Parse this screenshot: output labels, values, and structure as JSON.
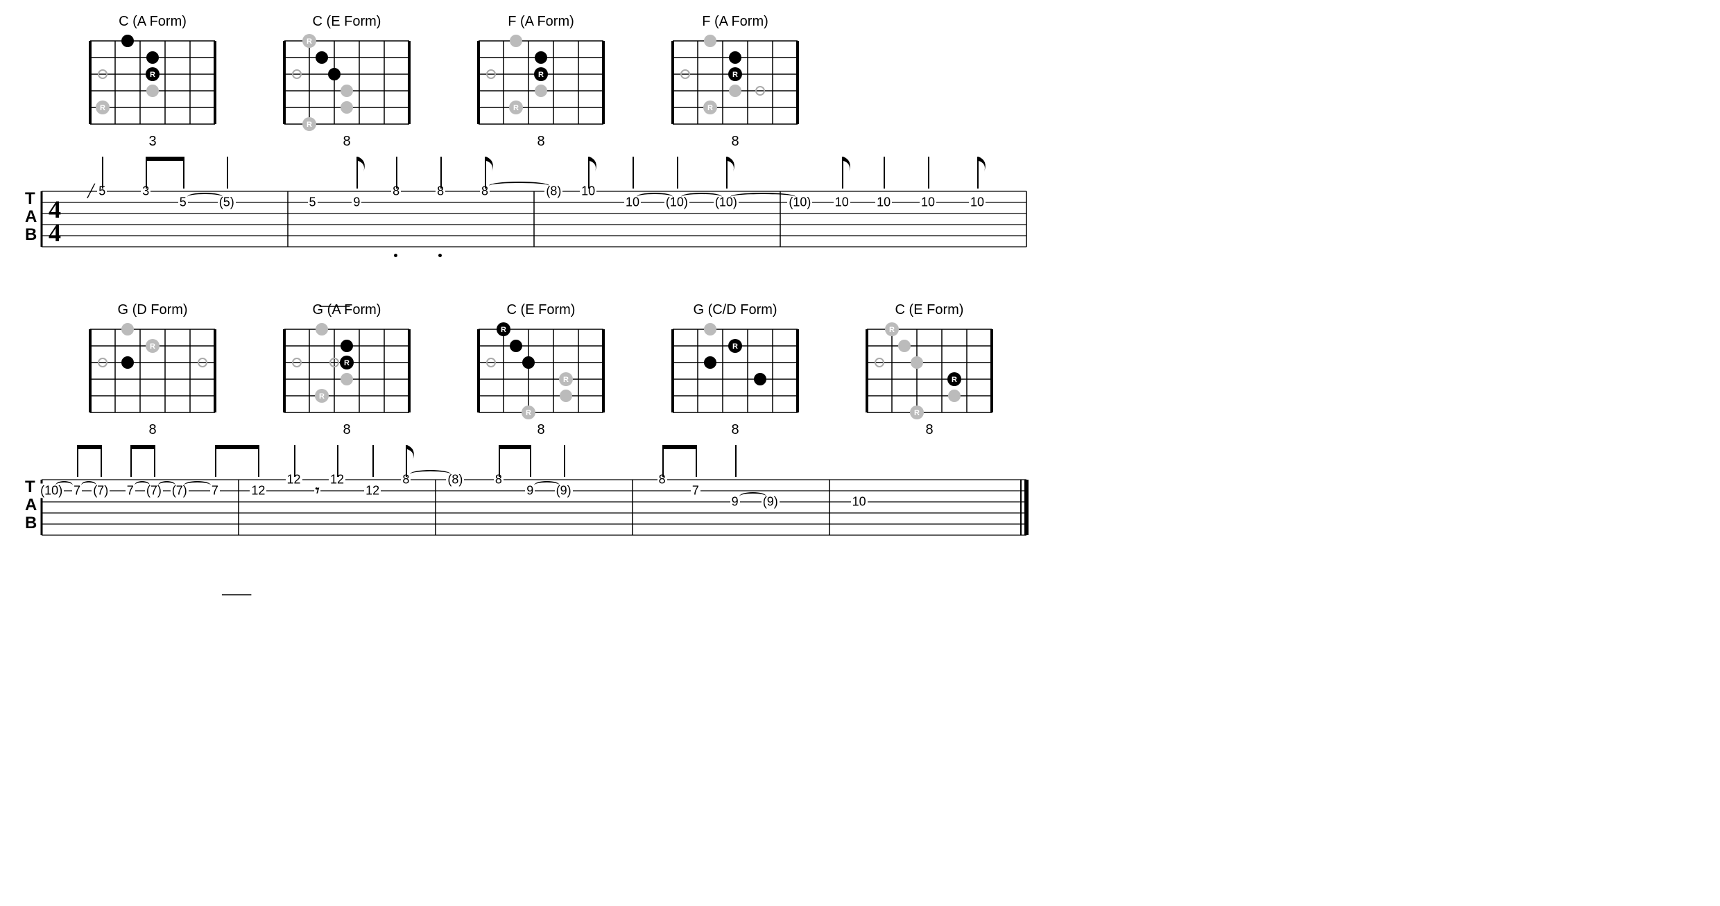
{
  "time_signature": "4/4",
  "tab_label": "TAB",
  "rows": [
    {
      "chords": [
        {
          "title": "C (A Form)",
          "position": "3",
          "dots": [
            {
              "string": 1,
              "fret": 2,
              "type": "black"
            },
            {
              "string": 2,
              "fret": 3,
              "type": "black"
            },
            {
              "string": 3,
              "fret": 3,
              "type": "root"
            },
            {
              "string": 3,
              "fret": 1,
              "type": "open"
            },
            {
              "string": 4,
              "fret": 3,
              "type": "grey"
            },
            {
              "string": 5,
              "fret": 1,
              "type": "greyroot"
            }
          ]
        },
        {
          "title": "C (E Form)",
          "position": "8",
          "dots": [
            {
              "string": 1,
              "fret": 1.5,
              "type": "greyroot"
            },
            {
              "string": 2,
              "fret": 2,
              "type": "black"
            },
            {
              "string": 3,
              "fret": 2.5,
              "type": "black"
            },
            {
              "string": 3,
              "fret": 1,
              "type": "open"
            },
            {
              "string": 4,
              "fret": 3,
              "type": "grey"
            },
            {
              "string": 5,
              "fret": 3,
              "type": "grey"
            },
            {
              "string": 6,
              "fret": 1.5,
              "type": "greyroot"
            }
          ]
        },
        {
          "title": "F (A Form)",
          "position": "8",
          "dots": [
            {
              "string": 1,
              "fret": 2,
              "type": "grey"
            },
            {
              "string": 2,
              "fret": 3,
              "type": "black"
            },
            {
              "string": 3,
              "fret": 3,
              "type": "root"
            },
            {
              "string": 3,
              "fret": 1,
              "type": "open"
            },
            {
              "string": 4,
              "fret": 3,
              "type": "grey"
            },
            {
              "string": 5,
              "fret": 2,
              "type": "greyroot"
            }
          ]
        },
        {
          "title": "F (A Form)",
          "position": "8",
          "dots": [
            {
              "string": 1,
              "fret": 2,
              "type": "grey"
            },
            {
              "string": 2,
              "fret": 3,
              "type": "black"
            },
            {
              "string": 3,
              "fret": 3,
              "type": "root"
            },
            {
              "string": 3,
              "fret": 1,
              "type": "open"
            },
            {
              "string": 4,
              "fret": 3,
              "type": "grey"
            },
            {
              "string": 4,
              "fret": 4,
              "type": "open"
            },
            {
              "string": 5,
              "fret": 2,
              "type": "greyroot"
            }
          ]
        }
      ],
      "measures": 4,
      "show_tab_label": true,
      "show_time_sig": true,
      "end_bar": "single",
      "notes": [
        {
          "measure": 0,
          "x": 0.15,
          "string": 1,
          "text": "5",
          "slash": true,
          "stem": true
        },
        {
          "measure": 0,
          "x": 0.35,
          "string": 1,
          "text": "3",
          "stem": true,
          "beam_to_next": true
        },
        {
          "measure": 0,
          "x": 0.52,
          "string": 2,
          "text": "5",
          "stem": true,
          "tie_to_next": true
        },
        {
          "measure": 0,
          "x": 0.72,
          "string": 2,
          "text": "(5)",
          "stem": true
        },
        {
          "measure": 1,
          "x": 0.1,
          "string": 2,
          "text": "5",
          "slide_to_next": true
        },
        {
          "measure": 1,
          "x": 0.28,
          "string": 2,
          "text": "9",
          "stem": true,
          "flag": true
        },
        {
          "measure": 1,
          "x": 0.44,
          "string": 1,
          "text": "8",
          "stem": true,
          "dot": true
        },
        {
          "measure": 1,
          "x": 0.62,
          "string": 1,
          "text": "8",
          "stem": true,
          "dot": true
        },
        {
          "measure": 1,
          "x": 0.8,
          "string": 1,
          "text": "8",
          "stem": true,
          "flag": true,
          "tie_to_next": true
        },
        {
          "measure": 2,
          "x": 0.08,
          "string": 1,
          "text": "(8)"
        },
        {
          "measure": 2,
          "x": 0.22,
          "string": 1,
          "text": "10",
          "stem": true,
          "flag": true
        },
        {
          "measure": 2,
          "x": 0.4,
          "string": 2,
          "text": "10",
          "stem": true,
          "tie_to_next": true
        },
        {
          "measure": 2,
          "x": 0.58,
          "string": 2,
          "text": "(10)",
          "stem": true,
          "tie_to_next": true
        },
        {
          "measure": 2,
          "x": 0.78,
          "string": 2,
          "text": "(10)",
          "stem": true,
          "flag": true,
          "tie_to_next": true
        },
        {
          "measure": 3,
          "x": 0.08,
          "string": 2,
          "text": "(10)"
        },
        {
          "measure": 3,
          "x": 0.25,
          "string": 2,
          "text": "10",
          "stem": true,
          "flag": true
        },
        {
          "measure": 3,
          "x": 0.42,
          "string": 2,
          "text": "10",
          "stem": true
        },
        {
          "measure": 3,
          "x": 0.6,
          "string": 2,
          "text": "10",
          "stem": true
        },
        {
          "measure": 3,
          "x": 0.8,
          "string": 2,
          "text": "10",
          "stem": true,
          "flag": true,
          "tie_to_next": true
        }
      ]
    },
    {
      "chords": [
        {
          "title": "G (D Form)",
          "position": "8",
          "dots": [
            {
              "string": 1,
              "fret": 2,
              "type": "grey"
            },
            {
              "string": 2,
              "fret": 3,
              "type": "greyroot"
            },
            {
              "string": 3,
              "fret": 2,
              "type": "black"
            },
            {
              "string": 3,
              "fret": 1,
              "type": "open"
            },
            {
              "string": 3,
              "fret": 5,
              "type": "open"
            }
          ]
        },
        {
          "title": "G (A Form)",
          "position": "8",
          "dots": [
            {
              "string": 1,
              "fret": 2,
              "type": "grey"
            },
            {
              "string": 2,
              "fret": 3,
              "type": "black"
            },
            {
              "string": 3,
              "fret": 3,
              "type": "root"
            },
            {
              "string": 3,
              "fret": 1,
              "type": "open"
            },
            {
              "string": 3,
              "fret": 2.5,
              "type": "open"
            },
            {
              "string": 4,
              "fret": 3,
              "type": "grey"
            },
            {
              "string": 5,
              "fret": 2,
              "type": "greyroot"
            }
          ]
        },
        {
          "title": "C (E Form)",
          "position": "8",
          "dots": [
            {
              "string": 1,
              "fret": 1.5,
              "type": "root"
            },
            {
              "string": 2,
              "fret": 2,
              "type": "black"
            },
            {
              "string": 3,
              "fret": 2.5,
              "type": "black"
            },
            {
              "string": 3,
              "fret": 1,
              "type": "open"
            },
            {
              "string": 4,
              "fret": 4,
              "type": "greyroot"
            },
            {
              "string": 5,
              "fret": 4,
              "type": "grey"
            },
            {
              "string": 6,
              "fret": 2.5,
              "type": "greyroot"
            }
          ]
        },
        {
          "title": "G (C/D Form)",
          "position": "8",
          "dots": [
            {
              "string": 1,
              "fret": 2,
              "type": "grey"
            },
            {
              "string": 2,
              "fret": 3,
              "type": "root"
            },
            {
              "string": 3,
              "fret": 2,
              "type": "black"
            },
            {
              "string": 4,
              "fret": 4,
              "type": "black"
            }
          ]
        },
        {
          "title": "C (E Form)",
          "position": "8",
          "dots": [
            {
              "string": 1,
              "fret": 1.5,
              "type": "greyroot"
            },
            {
              "string": 2,
              "fret": 2,
              "type": "grey"
            },
            {
              "string": 3,
              "fret": 2.5,
              "type": "grey"
            },
            {
              "string": 3,
              "fret": 1,
              "type": "open"
            },
            {
              "string": 4,
              "fret": 4,
              "type": "root"
            },
            {
              "string": 5,
              "fret": 4,
              "type": "grey"
            },
            {
              "string": 6,
              "fret": 2.5,
              "type": "greyroot"
            }
          ]
        }
      ],
      "measures": 5,
      "show_tab_label": true,
      "show_time_sig": false,
      "end_bar": "final",
      "notes": [
        {
          "measure": 0,
          "x": 0.05,
          "string": 2,
          "text": "(10)",
          "tie_to_next": true
        },
        {
          "measure": 0,
          "x": 0.18,
          "string": 2,
          "text": "7",
          "stem": true,
          "beam_to_next": true,
          "tie_to_next": true
        },
        {
          "measure": 0,
          "x": 0.3,
          "string": 2,
          "text": "(7)",
          "stem": true
        },
        {
          "measure": 0,
          "x": 0.45,
          "string": 2,
          "text": "7",
          "stem": true,
          "beam_to_next": true,
          "tie_to_next": true
        },
        {
          "measure": 0,
          "x": 0.57,
          "string": 2,
          "text": "(7)",
          "stem": true,
          "tie_to_next": true
        },
        {
          "measure": 0,
          "x": 0.7,
          "string": 2,
          "text": "(7)",
          "tie_to_next": true
        },
        {
          "measure": 0,
          "x": 0.88,
          "string": 2,
          "text": "7",
          "stem": true,
          "beam_to_next": true,
          "slide_to_next": true
        },
        {
          "measure": 1,
          "x": 0.1,
          "string": 2,
          "text": "12",
          "stem": true
        },
        {
          "measure": 1,
          "x": 0.28,
          "string": 1,
          "text": "12",
          "stem": true
        },
        {
          "measure": 1,
          "x": 0.4,
          "string": 2,
          "text": "7",
          "rest": true
        },
        {
          "measure": 1,
          "x": 0.5,
          "string": 1,
          "text": "12",
          "stem": true
        },
        {
          "measure": 1,
          "x": 0.68,
          "string": 2,
          "text": "12",
          "stem": true
        },
        {
          "measure": 1,
          "x": 0.85,
          "string": 1,
          "text": "8",
          "stem": true,
          "flag": true,
          "tie_to_next": true
        },
        {
          "measure": 2,
          "x": 0.1,
          "string": 1,
          "text": "(8)"
        },
        {
          "measure": 2,
          "x": 0.32,
          "string": 1,
          "text": "8",
          "stem": true,
          "beam_to_next": true
        },
        {
          "measure": 2,
          "x": 0.48,
          "string": 2,
          "text": "9",
          "stem": true,
          "tie_to_next": true
        },
        {
          "measure": 2,
          "x": 0.65,
          "string": 2,
          "text": "(9)",
          "stem": true
        },
        {
          "measure": 3,
          "x": 0.15,
          "string": 1,
          "text": "8",
          "stem": true,
          "beam_to_next": true
        },
        {
          "measure": 3,
          "x": 0.32,
          "string": 2,
          "text": "7",
          "stem": true
        },
        {
          "measure": 3,
          "x": 0.52,
          "string": 3,
          "text": "9",
          "stem": true,
          "tie_to_next": true
        },
        {
          "measure": 3,
          "x": 0.7,
          "string": 3,
          "text": "(9)"
        },
        {
          "measure": 4,
          "x": 0.15,
          "string": 3,
          "text": "10"
        }
      ]
    }
  ]
}
